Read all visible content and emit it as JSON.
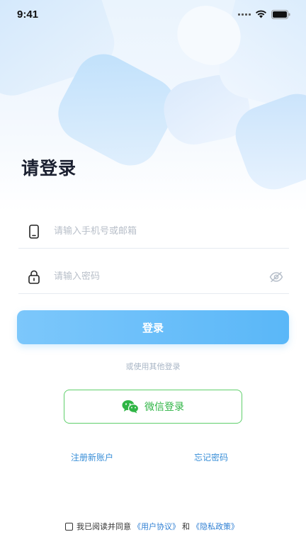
{
  "status_bar": {
    "time": "9:41"
  },
  "title": "请登录",
  "phone_field": {
    "placeholder": "请输入手机号或邮箱",
    "value": ""
  },
  "password_field": {
    "placeholder": "请输入密码",
    "value": ""
  },
  "login_button": {
    "label": "登录"
  },
  "other_login_label": "或使用其他登录",
  "wechat_button": {
    "label": "微信登录",
    "icon": "wechat-icon"
  },
  "links": {
    "register": "注册新账户",
    "forgot_password": "忘记密码"
  },
  "agreement": {
    "checked": false,
    "prefix": "我已阅读并同意",
    "user_agreement": "《用户协议》",
    "conjunction": "和",
    "privacy_policy": "《隐私政策》"
  },
  "colors": {
    "accent": "#5ab7f8",
    "wechat": "#2fb545",
    "link": "#3a8fd8"
  }
}
